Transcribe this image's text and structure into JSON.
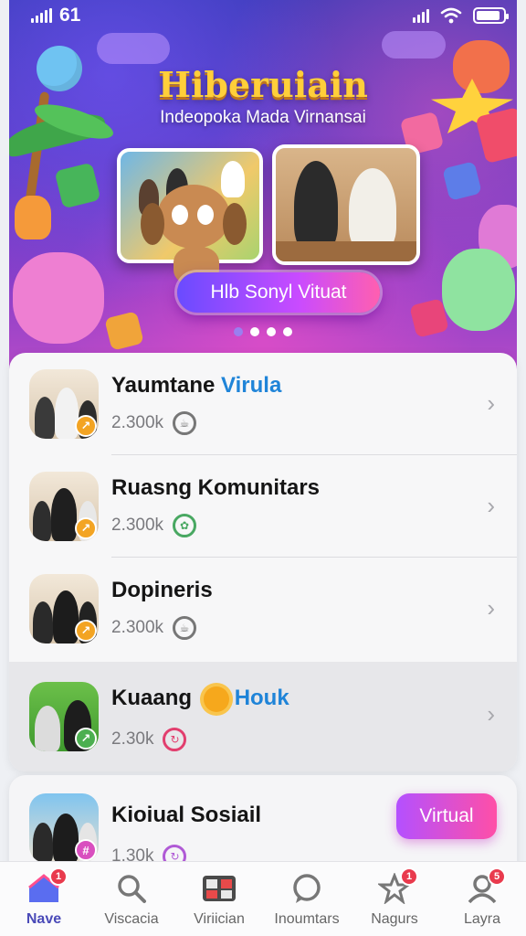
{
  "status_bar": {
    "time": "61"
  },
  "hero": {
    "title": "Hiberuiain",
    "subtitle": "Indeopoka Mada Virnansai",
    "button_label": "Hlb Sonyl Vituat"
  },
  "list": {
    "items": [
      {
        "title_main": "Yaumtane ",
        "title_highlight": "Virula",
        "count": "2.300k",
        "icon": "tea-icon"
      },
      {
        "title_main": "Ruasng Komunitars",
        "title_highlight": "",
        "count": "2.300k",
        "icon": "leaf-icon"
      },
      {
        "title_main": "Dopineris",
        "title_highlight": "",
        "count": "2.300k",
        "icon": "tea-icon"
      },
      {
        "title_main": "Kuaang ",
        "title_highlight": "Houk",
        "count": "2.30k",
        "icon": "refresh-icon"
      }
    ]
  },
  "card2": {
    "title": "Kioiual Sosiail",
    "count": "1.30k",
    "button_label": "Virtual"
  },
  "nav": {
    "items": [
      {
        "label": "Nave",
        "badge": "1"
      },
      {
        "label": "Viscacia",
        "badge": ""
      },
      {
        "label": "Viriician",
        "badge": ""
      },
      {
        "label": "Inoumtars",
        "badge": ""
      },
      {
        "label": "Nagurs",
        "badge": "1"
      },
      {
        "label": "Layra",
        "badge": "5"
      }
    ]
  },
  "colors": {
    "accent": "#4a4ab8",
    "highlight_text": "#1f84d8",
    "badge_red": "#e93a4d",
    "hero_title": "#ffcf3a"
  }
}
